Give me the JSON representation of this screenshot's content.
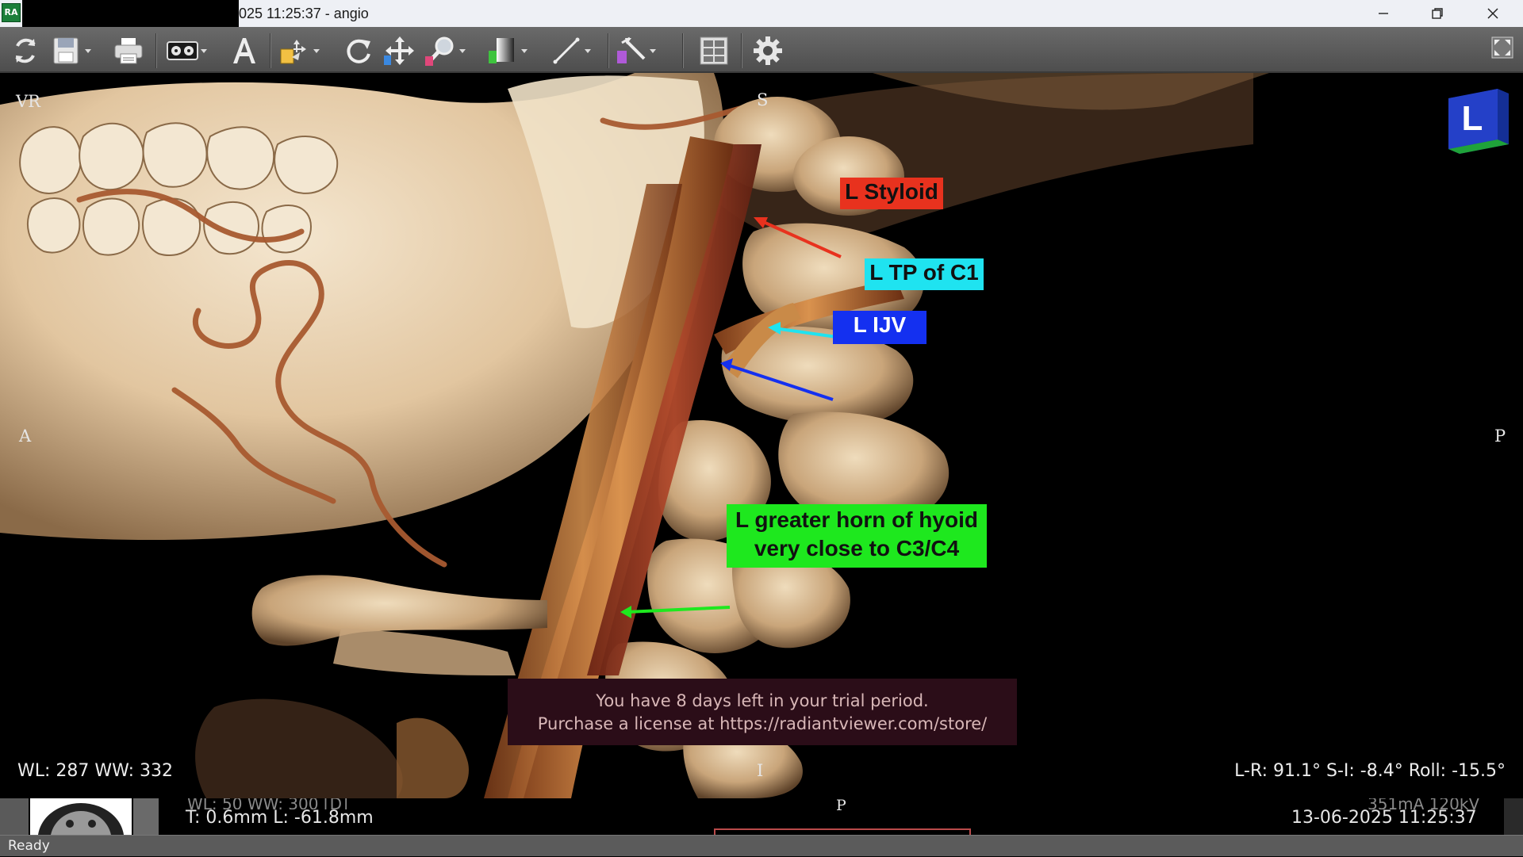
{
  "window": {
    "app_icon_text": "RA",
    "title": "025 11:25:37 - angio",
    "controls": [
      "minimize",
      "restore",
      "close"
    ]
  },
  "toolbar": {
    "tools": [
      {
        "name": "reset-view-icon"
      },
      {
        "name": "save-icon",
        "dropdown": true
      },
      {
        "name": "print-icon"
      },
      {
        "name": "cine-icon",
        "dropdown": true
      },
      {
        "name": "annotation-text-icon"
      },
      {
        "name": "browse-tool-icon",
        "dropdown": true
      },
      {
        "name": "rotate-icon"
      },
      {
        "name": "pan-icon"
      },
      {
        "name": "zoom-icon",
        "dropdown": true
      },
      {
        "name": "window-level-icon",
        "dropdown": true
      },
      {
        "name": "measure-line-icon",
        "dropdown": true
      },
      {
        "name": "crop-sculpt-icon",
        "dropdown": true
      },
      {
        "name": "layout-icon"
      },
      {
        "name": "settings-gear-icon"
      },
      {
        "name": "fullscreen-icon"
      }
    ]
  },
  "viewport": {
    "mode": "VR",
    "orientation": {
      "top": "S",
      "left": "A",
      "right": "P",
      "bottom": "I"
    },
    "orientation_cube_letter": "L",
    "window_level": "WL: 287 WW: 332",
    "rotation": "L-R: 91.1° S-I: -8.4° Roll: -15.5°",
    "annotations": [
      {
        "id": "styloid",
        "text": "L Styloid",
        "bg": "#e8321e",
        "fg": "#111111",
        "arrow": "#e8321e"
      },
      {
        "id": "tp-c1",
        "text": "L TP of C1",
        "bg": "#1fe3f0",
        "fg": "#111111",
        "arrow": "#1fe3f0"
      },
      {
        "id": "ijv",
        "text": "L IJV",
        "bg": "#1430f0",
        "fg": "#ffffff",
        "arrow": "#1430f0"
      },
      {
        "id": "hyoid",
        "line1": "L greater horn of hyoid",
        "line2": "very close to C3/C4",
        "bg": "#1ee81e",
        "fg": "#111111",
        "arrow": "#1ee81e"
      }
    ],
    "trial_notice": {
      "line1": "You have 8 days left in your trial period.",
      "line2": "Purchase a license at https://radiantviewer.com/store/"
    }
  },
  "lower_strip": {
    "ghost_left": "WL: 50 WW: 300 [D]",
    "thickness_location": "T: 0.6mm L: -61.8mm",
    "orientation_letter": "P",
    "ghost_right": "351mA 120kV",
    "datetime": "13-06-2025 11:25:37"
  },
  "status": {
    "text": "Ready"
  },
  "colors": {
    "titlebar_bg": "#eef0f5",
    "toolbar_bg": "#5a5a5a",
    "trial_bg": "#2b0d18",
    "bone": "#e8d3b4",
    "vessel": "#b3582e"
  }
}
